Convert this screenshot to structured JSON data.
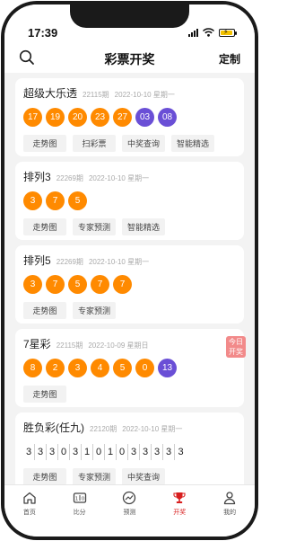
{
  "status": {
    "time": "17:39"
  },
  "header": {
    "title": "彩票开奖",
    "right_action": "定制"
  },
  "cards": [
    {
      "name": "超级大乐透",
      "issue": "22115期",
      "date": "2022-10-10 星期一",
      "red_balls": [
        "17",
        "19",
        "20",
        "23",
        "27"
      ],
      "blue_balls": [
        "03",
        "08"
      ],
      "actions": [
        "走势图",
        "扫彩票",
        "中奖查询",
        "智能精选"
      ]
    },
    {
      "name": "排列3",
      "issue": "22269期",
      "date": "2022-10-10 星期一",
      "red_balls": [
        "3",
        "7",
        "5"
      ],
      "actions": [
        "走势图",
        "专家预测",
        "智能精选"
      ]
    },
    {
      "name": "排列5",
      "issue": "22269期",
      "date": "2022-10-10 星期一",
      "red_balls": [
        "3",
        "7",
        "5",
        "7",
        "7"
      ],
      "actions": [
        "走势图",
        "专家预测"
      ]
    },
    {
      "name": "7星彩",
      "issue": "22115期",
      "date": "2022-10-09 星期日",
      "badge": "今日\n开奖",
      "red_balls": [
        "8",
        "2",
        "3",
        "4",
        "5",
        "0"
      ],
      "blue_balls": [
        "13"
      ],
      "actions": [
        "走势图"
      ]
    },
    {
      "name": "胜负彩(任九)",
      "issue": "22120期",
      "date": "2022-10-10 星期一",
      "digits": [
        "3",
        "3",
        "3",
        "0",
        "3",
        "1",
        "0",
        "1",
        "0",
        "3",
        "3",
        "3",
        "3",
        "3"
      ],
      "actions": [
        "走势图",
        "专家预测",
        "中奖查询"
      ]
    }
  ],
  "tabs": [
    {
      "label": "首页",
      "icon": "home-icon"
    },
    {
      "label": "比分",
      "icon": "scoreboard-icon"
    },
    {
      "label": "预测",
      "icon": "trend-icon"
    },
    {
      "label": "开奖",
      "icon": "trophy-icon",
      "active": true
    },
    {
      "label": "我的",
      "icon": "user-icon"
    }
  ],
  "colors": {
    "red_ball": "#ff8a00",
    "blue_ball": "#6a4fd6",
    "active_tab": "#d81e1e",
    "badge": "#f28a8a"
  }
}
